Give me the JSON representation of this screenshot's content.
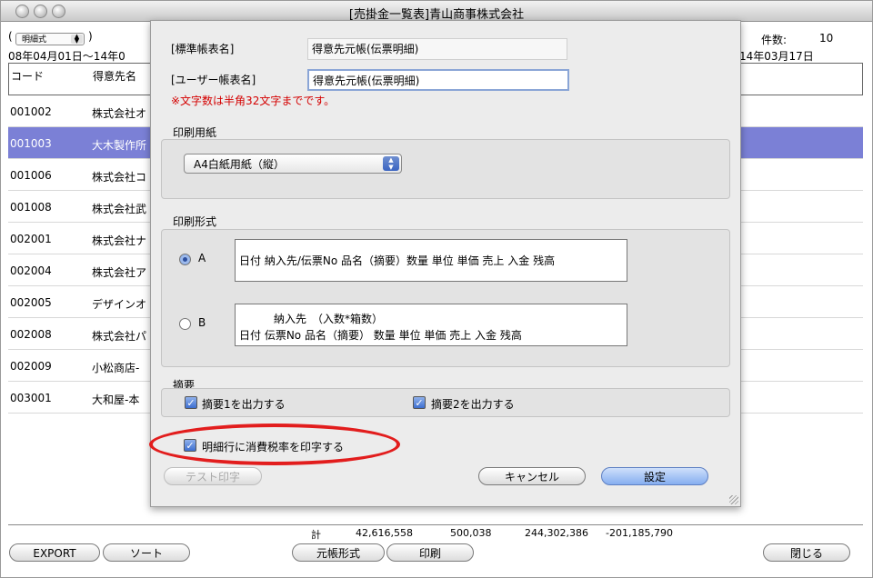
{
  "window": {
    "title": "[売掛金一覧表]青山商事株式会社"
  },
  "list": {
    "mode_select": "明細式",
    "paren_open": "(",
    "paren_close": ")",
    "date_range": "08年04月01日〜14年0",
    "count_label": "件数:",
    "count_value": "10",
    "right_date": "14年03月17日",
    "columns": {
      "code": "コード",
      "name": "得意先名"
    },
    "rows": [
      {
        "code": "001002",
        "name": "株式会社オ"
      },
      {
        "code": "001003",
        "name": "大木製作所"
      },
      {
        "code": "001006",
        "name": "株式会社コ"
      },
      {
        "code": "001008",
        "name": "株式会社武"
      },
      {
        "code": "002001",
        "name": "株式会社ナ"
      },
      {
        "code": "002004",
        "name": "株式会社ア"
      },
      {
        "code": "002005",
        "name": "デザインオ"
      },
      {
        "code": "002008",
        "name": "株式会社パ"
      },
      {
        "code": "002009",
        "name": "小松商店-"
      },
      {
        "code": "003001",
        "name": "大和屋-本"
      }
    ],
    "selected_index": 1,
    "totals": {
      "label": "計",
      "v1": "42,616,558",
      "v2": "500,038",
      "v3": "244,302,386",
      "v4": "-201,185,790"
    }
  },
  "bottom_buttons": {
    "export": "EXPORT",
    "sort": "ソート",
    "ledger_format": "元帳形式",
    "print": "印刷",
    "close": "閉じる"
  },
  "dialog": {
    "standard_name_label": "[標準帳表名]",
    "standard_name_value": "得意先元帳(伝票明細)",
    "user_name_label": "[ユーザー帳表名]",
    "user_name_value": "得意先元帳(伝票明細)",
    "warning": "※文字数は半角32文字までです。",
    "paper_section": "印刷用紙",
    "paper_value": "A4白紙用紙（縦）",
    "format_section": "印刷形式",
    "format_a_label": "A",
    "format_a_text": "日付 納入先/伝票No 品名（摘要）数量  単位  単価  売上  入金  残高",
    "format_b_label": "B",
    "format_b_line1": "納入先　（入数*箱数）",
    "format_b_line2": "日付  伝票No   品名（摘要）        数量  単位  単価  売上  入金  残高",
    "selected_format": "A",
    "memo_section": "摘要",
    "memo1": "摘要1を出力する",
    "memo1_checked": true,
    "memo2": "摘要2を出力する",
    "memo2_checked": true,
    "tax_rate": "明細行に消費税率を印字する",
    "tax_rate_checked": true,
    "test_print": "テスト印字",
    "cancel": "キャンセル",
    "ok": "設定"
  },
  "colors": {
    "selection": "#7b80d6",
    "highlight_ellipse": "#e21d1d",
    "warning_text": "#d40000"
  }
}
